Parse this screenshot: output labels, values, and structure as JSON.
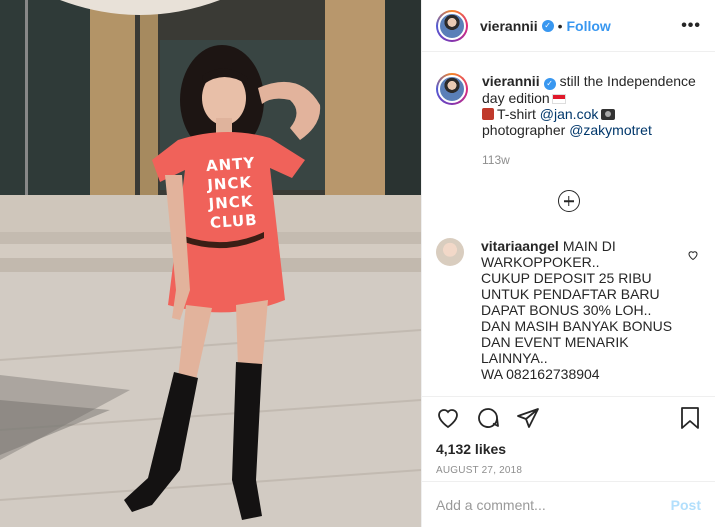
{
  "post": {
    "username": "vierannii",
    "follow_label": "Follow",
    "separator": "•",
    "more_label": "•••",
    "caption_text": "still the Independence day edition",
    "caption_line2_prefix": "T-shirt",
    "caption_mention1": "@jan.cok",
    "caption_line3_prefix": "photographer",
    "caption_mention2": "@zakymotret",
    "time_ago": "113w"
  },
  "comment": {
    "username": "vitariaangel",
    "lines": [
      "MAIN DI",
      "WARKOPPOKER..",
      "CUKUP DEPOSIT 25 RIBU",
      "UNTUK PENDAFTAR BARU",
      "DAPAT BONUS 30% LOH..",
      "DAN MASIH BANYAK BONUS",
      "DAN EVENT MENARIK",
      "LAINNYA..",
      "WA 082162738904"
    ]
  },
  "stats": {
    "likes": "4,132 likes",
    "date": "AUGUST 27, 2018"
  },
  "composer": {
    "placeholder": "Add a comment...",
    "post_label": "Post"
  },
  "photo": {
    "shirt_print": [
      "ANTY",
      "JNCK",
      "JNCK",
      "CLUB"
    ]
  },
  "colors": {
    "accent": "#3897f0",
    "shirt": "#f0625a",
    "post_disabled": "#b2dffc"
  },
  "icons": [
    "heart-icon",
    "comment-icon",
    "share-icon",
    "bookmark-icon",
    "more-icon",
    "verified-icon",
    "add-comment-icon"
  ]
}
